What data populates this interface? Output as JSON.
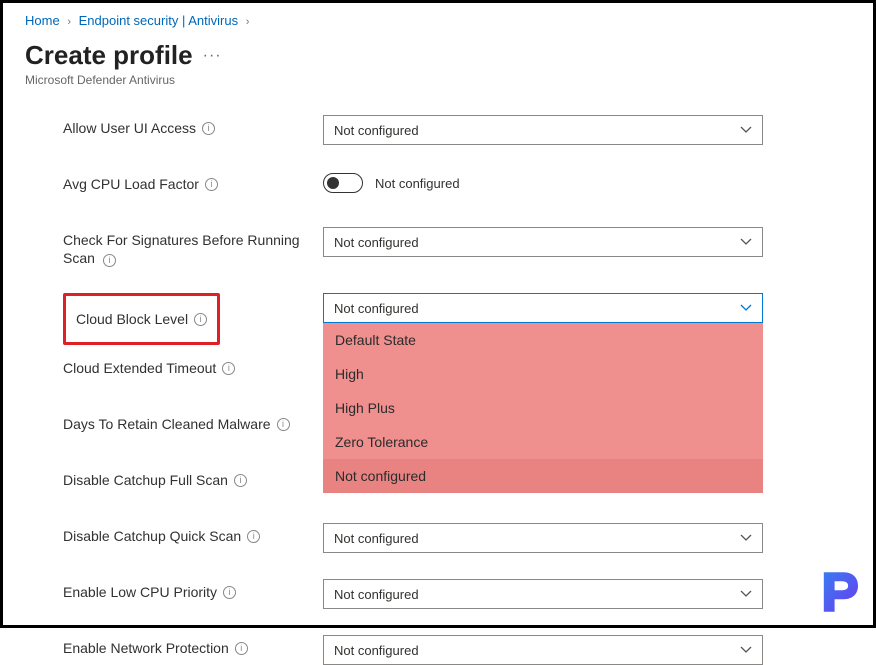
{
  "breadcrumb": {
    "home": "Home",
    "section": "Endpoint security | Antivirus"
  },
  "header": {
    "title": "Create profile",
    "subtitle": "Microsoft Defender Antivirus"
  },
  "common": {
    "not_configured": "Not configured"
  },
  "settings": {
    "allow_ui": {
      "label": "Allow User UI Access",
      "value": "Not configured"
    },
    "cpu_load": {
      "label": "Avg CPU Load Factor",
      "value": "Not configured"
    },
    "check_sig": {
      "label": "Check For Signatures Before Running Scan",
      "value": "Not configured"
    },
    "cloud_block": {
      "label": "Cloud Block Level",
      "value": "Not configured",
      "options": [
        "Default State",
        "High",
        "High Plus",
        "Zero Tolerance",
        "Not configured"
      ]
    },
    "cloud_ext": {
      "label": "Cloud Extended Timeout"
    },
    "days_retain": {
      "label": "Days To Retain Cleaned Malware"
    },
    "disable_full": {
      "label": "Disable Catchup Full Scan"
    },
    "disable_quick": {
      "label": "Disable Catchup Quick Scan",
      "value": "Not configured"
    },
    "low_cpu": {
      "label": "Enable Low CPU Priority",
      "value": "Not configured"
    },
    "net_protect": {
      "label": "Enable Network Protection",
      "value": "Not configured"
    }
  }
}
